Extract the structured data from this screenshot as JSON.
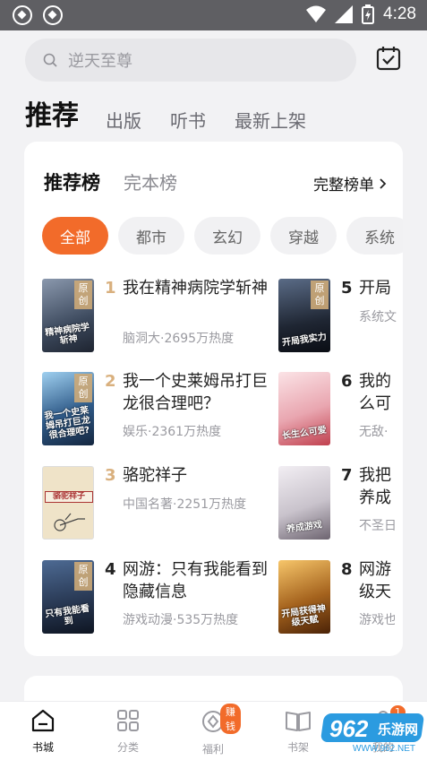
{
  "status_bar": {
    "time": "4:28"
  },
  "search": {
    "placeholder": "逆天至尊"
  },
  "top_tabs": [
    {
      "label": "推荐",
      "active": true
    },
    {
      "label": "出版"
    },
    {
      "label": "听书"
    },
    {
      "label": "最新上架"
    }
  ],
  "rank_tabs": [
    {
      "label": "推荐榜",
      "active": true
    },
    {
      "label": "完本榜"
    }
  ],
  "full_rank_link": "完整榜单",
  "chips": [
    "全部",
    "都市",
    "玄幻",
    "穿越",
    "系统"
  ],
  "books": [
    {
      "rank": "1",
      "title": "我在精神病院学斩神",
      "meta": "脑洞大·2695万热度",
      "tag": "原创",
      "cover_text": "精神病院学斩神",
      "cover_color": "#3d4a5e"
    },
    {
      "rank": "2",
      "title": "我一个史莱姆吊打巨龙很合理吧？",
      "meta": "娱乐·2361万热度",
      "tag": "原创",
      "cover_text": "我一个史莱姆吊打巨龙很合理吧?",
      "cover_color": "#2f5a88"
    },
    {
      "rank": "3",
      "title": "骆驼祥子",
      "meta": "中国名著·2251万热度",
      "tag": "",
      "cover_text": "骆驼祥子",
      "cover_color": "#efe3c8"
    },
    {
      "rank": "4",
      "title": "网游：只有我能看到隐藏信息",
      "meta": "游戏动漫·535万热度",
      "tag": "原创",
      "cover_text": "只有我能看到",
      "cover_color": "#26354f"
    },
    {
      "rank": "5",
      "title": "开局",
      "meta": "系统文",
      "tag": "原创",
      "cover_text": "开局我实力",
      "cover_color": "#1f2633"
    },
    {
      "rank": "6",
      "title": "我的么可",
      "meta": "无敌·",
      "tag": "",
      "cover_text": "长生么可爱",
      "cover_color": "#e9a6b0"
    },
    {
      "rank": "7",
      "title": "我把养成",
      "meta": "不圣日",
      "tag": "",
      "cover_text": "养成游戏",
      "cover_color": "#c9c3cc"
    },
    {
      "rank": "8",
      "title": "网游级天",
      "meta": "游戏也",
      "tag": "",
      "cover_text": "开局获得神级天赋",
      "cover_color": "#a4621d"
    }
  ],
  "bottom_nav": [
    {
      "label": "书城",
      "active": true,
      "icon": "home-icon"
    },
    {
      "label": "分类",
      "icon": "grid-icon"
    },
    {
      "label": "福利",
      "icon": "coin-icon",
      "badge": "赚钱"
    },
    {
      "label": "书架",
      "icon": "book-icon"
    },
    {
      "label": "我的",
      "icon": "user-icon",
      "badge": "1"
    }
  ],
  "watermark": {
    "brand": "962",
    "domain": "乐游网",
    "url": "WWW.962.NET"
  },
  "colors": {
    "accent": "#f26b2a",
    "rank_gold": "#d9b07e"
  }
}
